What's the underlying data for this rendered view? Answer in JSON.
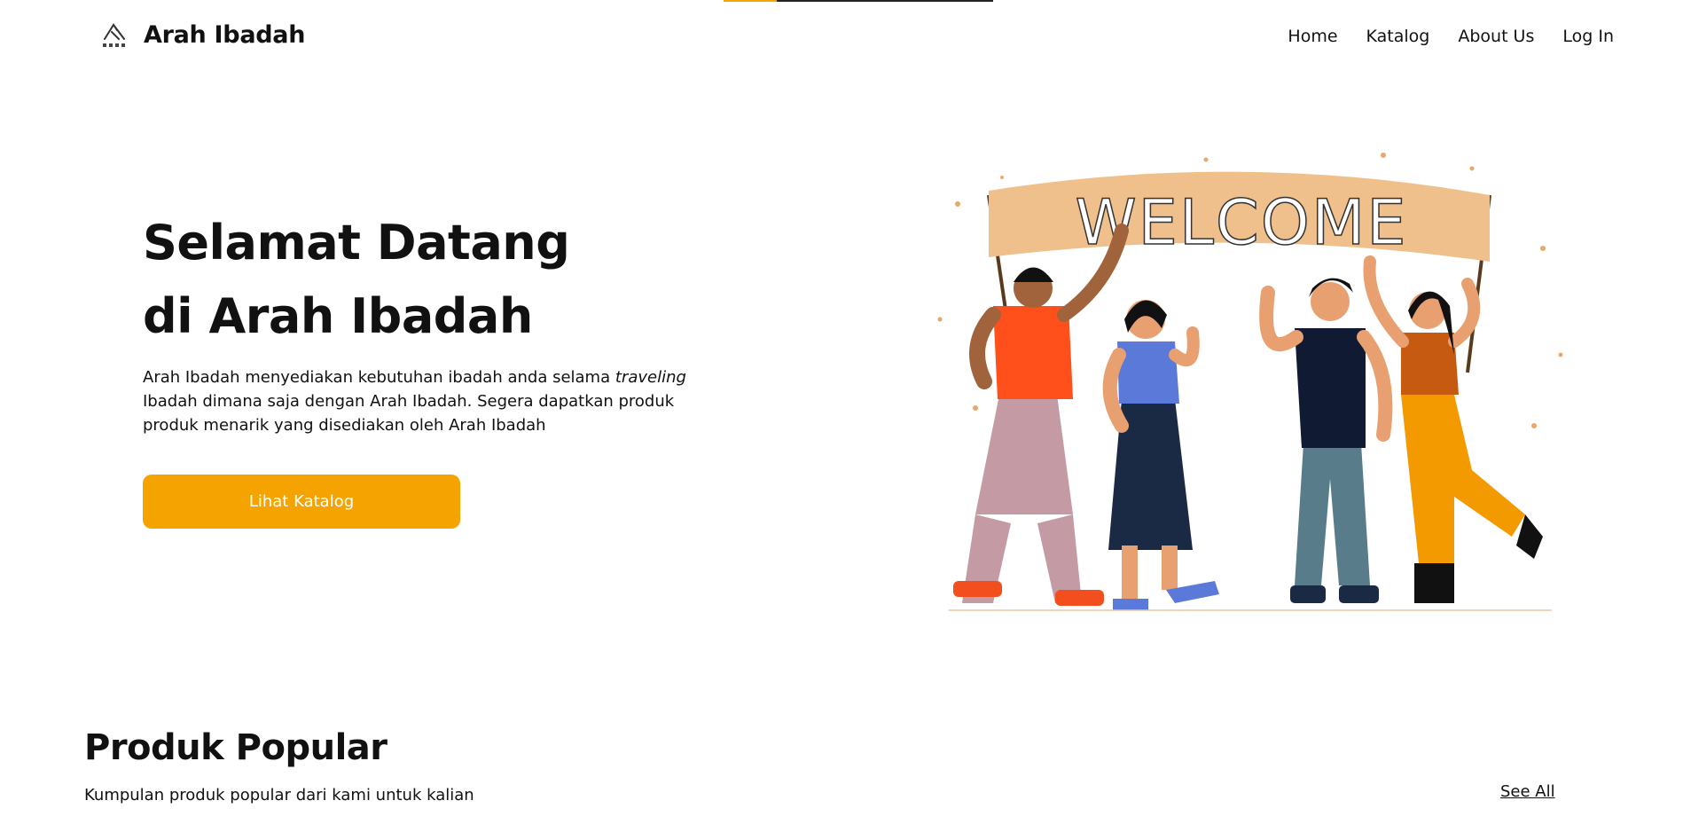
{
  "colors": {
    "accent": "#F5A300",
    "banner": "#F0C08C",
    "text": "#111111"
  },
  "brand": {
    "name": "Arah Ibadah",
    "logo_icon": "mountain-logo-icon"
  },
  "nav": {
    "items": [
      "Home",
      "Katalog",
      "About Us",
      "Log In"
    ]
  },
  "hero": {
    "title_line1": "Selamat Datang",
    "title_line2": "di Arah Ibadah",
    "desc_part1": "Arah Ibadah menyediakan kebutuhan ibadah anda selama ",
    "desc_italic": "traveling",
    "desc_part2": "Ibadah dimana saja dengan Arah Ibadah. Segera dapatkan produk produk menarik yang disediakan oleh Arah Ibadah",
    "cta_label": "Lihat Katalog",
    "banner_text": "WELCOME"
  },
  "popular": {
    "title": "Produk Popular",
    "subtitle": "Kumpulan produk popular dari kami untuk kalian",
    "see_all": "See All"
  }
}
